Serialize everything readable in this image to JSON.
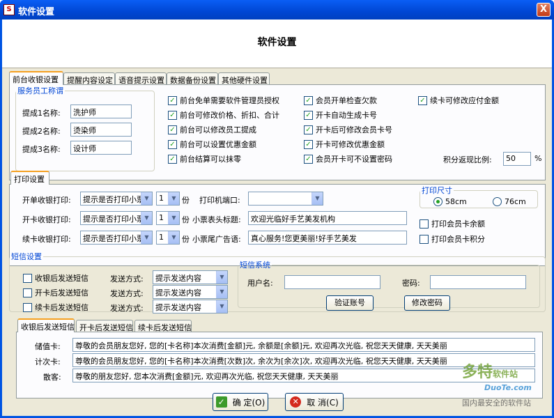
{
  "window": {
    "title": "软件设置",
    "close_label": "X",
    "app_icon": "app-icon"
  },
  "header": {
    "title": "软件设置"
  },
  "main_tabs": [
    "前台收银设置",
    "提醒内容设定",
    "语音提示设置",
    "数据备份设置",
    "其他硬件设置"
  ],
  "staff": {
    "legend": "服务员工称谓",
    "items": [
      {
        "label": "提成1名称:",
        "value": "洗护师"
      },
      {
        "label": "提成2名称:",
        "value": "烫染师"
      },
      {
        "label": "提成3名称:",
        "value": "设计师"
      }
    ]
  },
  "options": {
    "col1": [
      "前台免单需要软件管理员授权",
      "前台可修改价格、折扣、合计",
      "前台可以修改员工提成",
      "前台可以设置优惠金额",
      "前台结算可以抹零"
    ],
    "col2": [
      "会员开单检查欠款",
      "开卡自动生成卡号",
      "开卡后可修改会员卡号",
      "开卡可修改优惠金额",
      "会员开卡可不设置密码"
    ],
    "col3": [
      "续卡可修改应付金额"
    ],
    "ratio_label": "积分返现比例:",
    "ratio_value": "50",
    "ratio_unit": "%"
  },
  "print": {
    "tab": "打印设置",
    "rows": [
      {
        "label": "开单收银打印:",
        "mode": "提示是否打印小票",
        "copies": "1",
        "unit": "份"
      },
      {
        "label": "开卡收银打印:",
        "mode": "提示是否打印小票",
        "copies": "1",
        "unit": "份"
      },
      {
        "label": "续卡收银打印:",
        "mode": "提示是否打印小票",
        "copies": "1",
        "unit": "份"
      }
    ],
    "port_label": "打印机端口:",
    "port_value": "",
    "receipt_title_label": "小票表头标题:",
    "receipt_title_value": "欢迎光临好手艺美发机构",
    "receipt_ad_label": "小票尾广告语:",
    "receipt_ad_value": "真心服务!您更美丽!好手艺美发",
    "size_legend": "打印尺寸",
    "size_58": "58cm",
    "size_76": "76cm",
    "balance_label": "打印会员卡余额",
    "points_label": "打印会员卡积分"
  },
  "sms": {
    "legend": "短信设置",
    "rows": [
      {
        "label": "收银后发送短信",
        "method_label": "发送方式:",
        "method": "提示发送内容"
      },
      {
        "label": "开卡后发送短信",
        "method_label": "发送方式:",
        "method": "提示发送内容"
      },
      {
        "label": "续卡后发送短信",
        "method_label": "发送方式:",
        "method": "提示发送内容"
      }
    ],
    "system_legend": "短信系统",
    "user_label": "用户名:",
    "user_value": "",
    "pwd_label": "密码:",
    "pwd_value": "",
    "verify_btn": "验证账号",
    "change_pwd_btn": "修改密码"
  },
  "sms_tabs": [
    "收银后发送短信",
    "开卡后发送短信",
    "续卡后发送短信"
  ],
  "templates": [
    {
      "label": "储值卡:",
      "text": "尊敬的会员朋友您好, 您的[卡名称]本次消费[金额]元, 余额是[余额]元, 欢迎再次光临, 祝您天天健康, 天天美丽"
    },
    {
      "label": "计次卡:",
      "text": "尊敬的会员朋友您好, 您的[卡名称]本次消费[次数]次, 余次为[余次]次, 欢迎再次光临, 祝您天天健康, 天天美丽"
    },
    {
      "label": "散客:",
      "text": "尊敬的朋友您好, 您本次消费[金额]元, 欢迎再次光临, 祝您天天健康, 天天美丽"
    }
  ],
  "buttons": {
    "ok": "确 定(O)",
    "cancel": "取 消(C)"
  },
  "watermark": {
    "brand": "多特",
    "brand_sub": "软件站",
    "url": "DuoTe.com",
    "slogan": "国内最安全的软件站"
  },
  "colors": {
    "title_bar": "#0054e3",
    "legend": "#0046d5",
    "check": "#21a121",
    "face": "#ece9d8"
  }
}
